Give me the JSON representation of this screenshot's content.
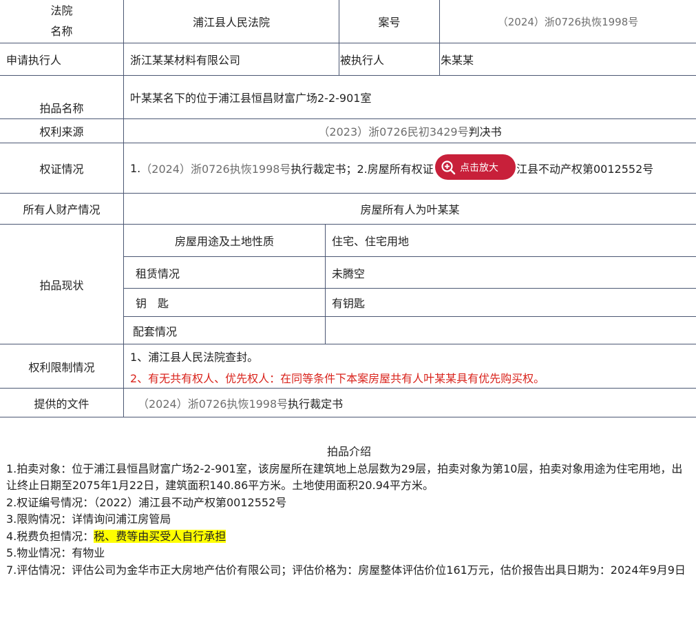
{
  "table": {
    "court_label_line1": "法院",
    "court_label_line2": "名称",
    "court_name": "浦江县人民法院",
    "case_no_label": "案号",
    "case_no": "（2024）浙0726执恢1998号",
    "applicant_label": "申请执行人",
    "applicant": "浙江某某材料有限公司",
    "respondent_label": "被执行人",
    "respondent": "朱某某",
    "item_name_label": "拍品名称",
    "item_name": "叶某某名下的位于浦江县恒昌财富广场2-2-901室",
    "rights_source_label": "权利来源",
    "rights_source_gray": "（2023）浙0726民初3429号",
    "rights_source_black": "判决书",
    "cert_label": "权证情况",
    "cert_prefix": "1.",
    "cert_gray": "（2024）浙0726执恢1998号",
    "cert_black_1": "执行裁定书；2.房屋所有权证",
    "cert_black_2": "江县不动产权第0012552号",
    "owner_label": "所有人财产情况",
    "owner": "房屋所有人为叶某某",
    "status_label": "拍品现状",
    "usage_label": "房屋用途及土地性质",
    "usage_value": "住宅、住宅用地",
    "lease_label": "租赁情况",
    "lease_value": "未腾空",
    "key_label": "钥　匙",
    "key_value": "有钥匙",
    "facility_label": "配套情况",
    "facility_value": "",
    "limit_label": "权利限制情况",
    "limit_1": "1、浦江县人民法院查封。",
    "limit_2": "2、有无共有权人、优先权人：在同等条件下本案房屋共有人叶某某具有优先购买权。",
    "docs_label": "提供的文件",
    "docs_gray": "（2024）浙0726执恢1998号",
    "docs_black": "执行裁定书"
  },
  "zoom_button": {
    "label": "点击放大",
    "icon": "zoom-in-icon"
  },
  "intro": {
    "title": "拍品介绍",
    "line1": "1.拍卖对象：位于浦江县恒昌财富广场2-2-901室，该房屋所在建筑地上总层数为29层，拍卖对象为第10层，拍卖对象用途为住宅用地，出让终止日期至2075年1月22日，建筑面积140.86平方米。土地使用面积20.94平方米。",
    "line2": "2.权证编号情况：（2022）浦江县不动产权第0012552号",
    "line3": "3.限购情况：详情询问浦江房管局",
    "line4_prefix": "4.税费负担情况：",
    "line4_highlight": "税、费等由买受人自行承担",
    "line5": "5.物业情况：有物业",
    "line7": "7.评估情况：评估公司为金华市正大房地产估价有限公司；评估价格为：房屋整体评估价位161万元，估价报告出具日期为：2024年9月9日"
  },
  "colors": {
    "border": "#4a5672",
    "red_text": "#d9231c",
    "zoom_button_bg": "#c8203a",
    "highlight": "#ffff00",
    "gray_text": "#6e6e6e"
  }
}
